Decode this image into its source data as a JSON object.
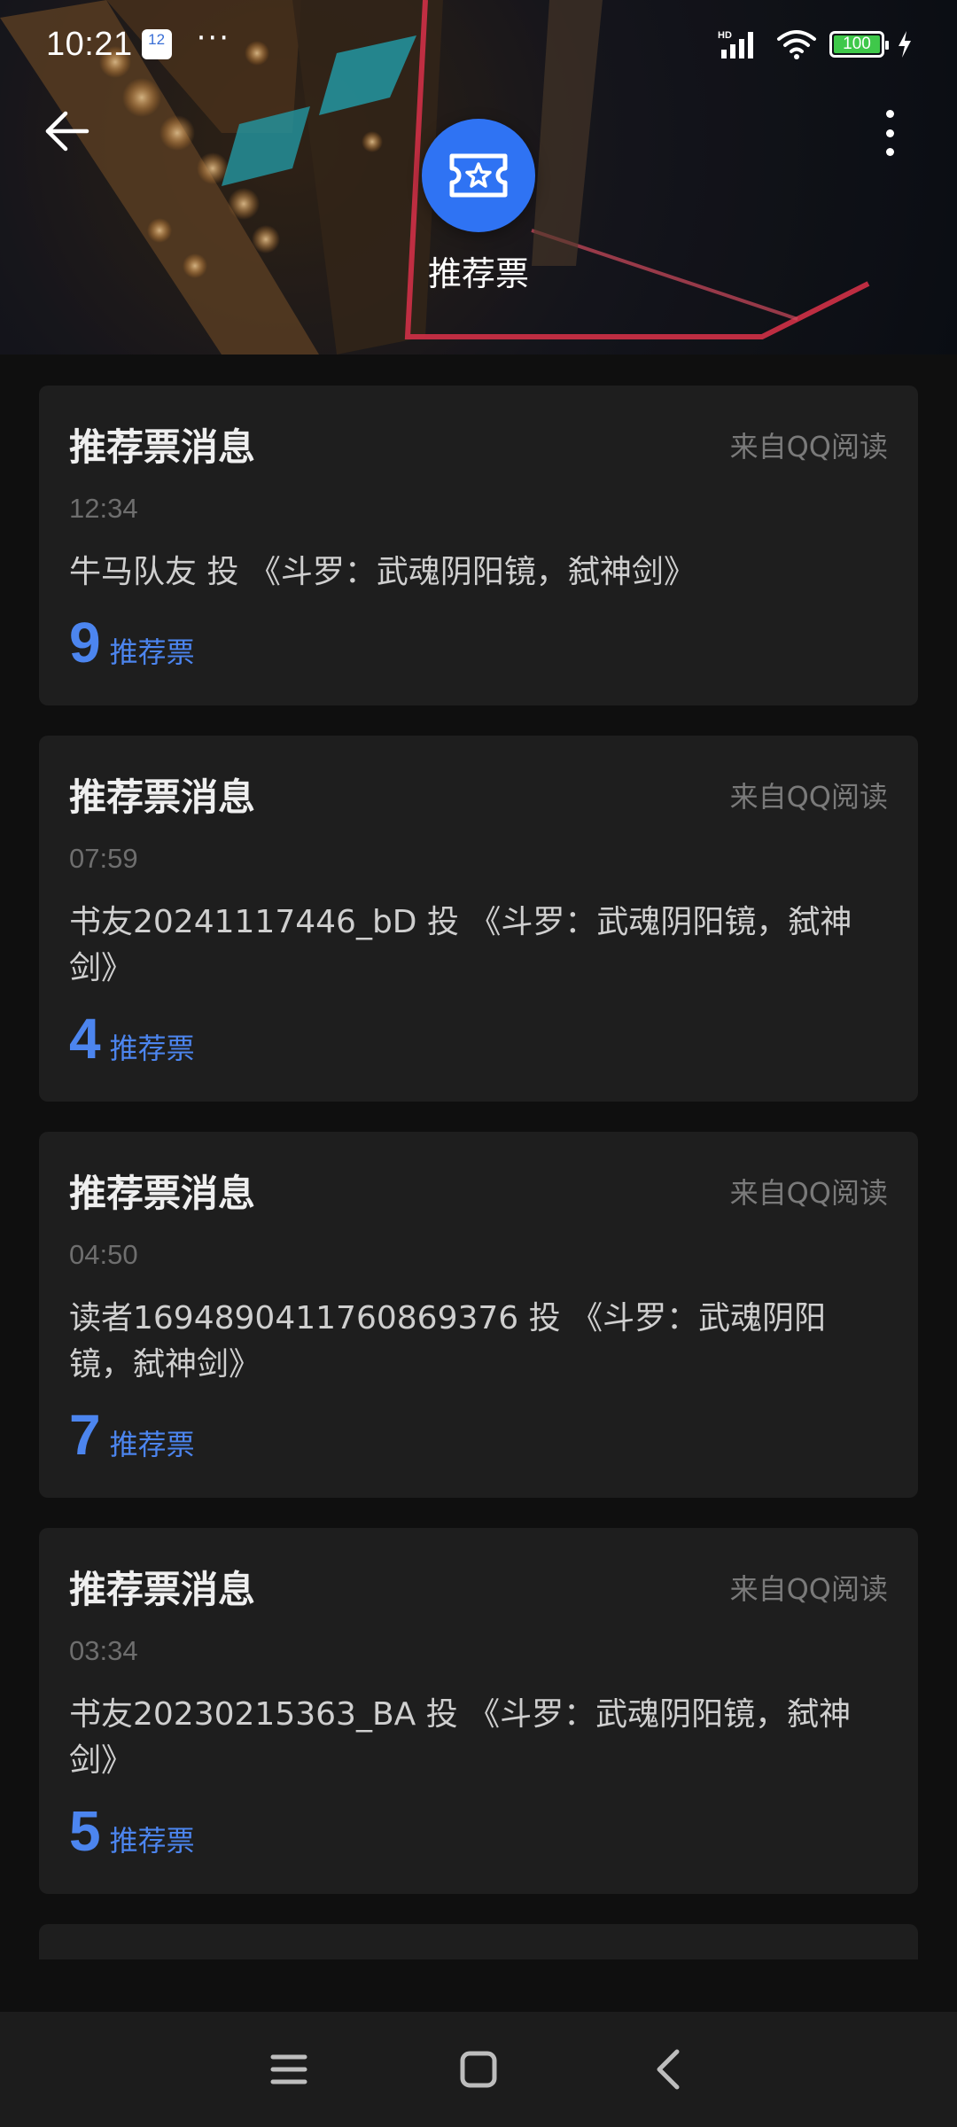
{
  "status_bar": {
    "time": "10:21",
    "calendar_badge": "12",
    "more_indicator": "···",
    "network": "HD",
    "battery_level": "100",
    "battery_color": "#3fc84a"
  },
  "header": {
    "title": "推荐票",
    "badge_color": "#2f73f3"
  },
  "messages": [
    {
      "title": "推荐票消息",
      "source": "来自QQ阅读",
      "time": "12:34",
      "body": "牛马队友 投 《斗罗：武魂阴阳镜，弑神剑》",
      "votes": "9",
      "votes_label": "推荐票"
    },
    {
      "title": "推荐票消息",
      "source": "来自QQ阅读",
      "time": "07:59",
      "body": "书友20241117446_bD 投 《斗罗：武魂阴阳镜，弑神剑》",
      "votes": "4",
      "votes_label": "推荐票"
    },
    {
      "title": "推荐票消息",
      "source": "来自QQ阅读",
      "time": "04:50",
      "body": "读者1694890411760869376 投 《斗罗：武魂阴阳镜，弑神剑》",
      "votes": "7",
      "votes_label": "推荐票"
    },
    {
      "title": "推荐票消息",
      "source": "来自QQ阅读",
      "time": "03:34",
      "body": "书友20230215363_BA 投 《斗罗：武魂阴阳镜，弑神剑》",
      "votes": "5",
      "votes_label": "推荐票"
    }
  ],
  "accent_color": "#4c85ef",
  "icons": {
    "back": "arrow-left-icon",
    "more": "more-vertical-icon",
    "ticket": "ticket-star-icon",
    "nav_menu": "menu-icon",
    "nav_home": "home-square-icon",
    "nav_back": "chevron-left-icon"
  }
}
